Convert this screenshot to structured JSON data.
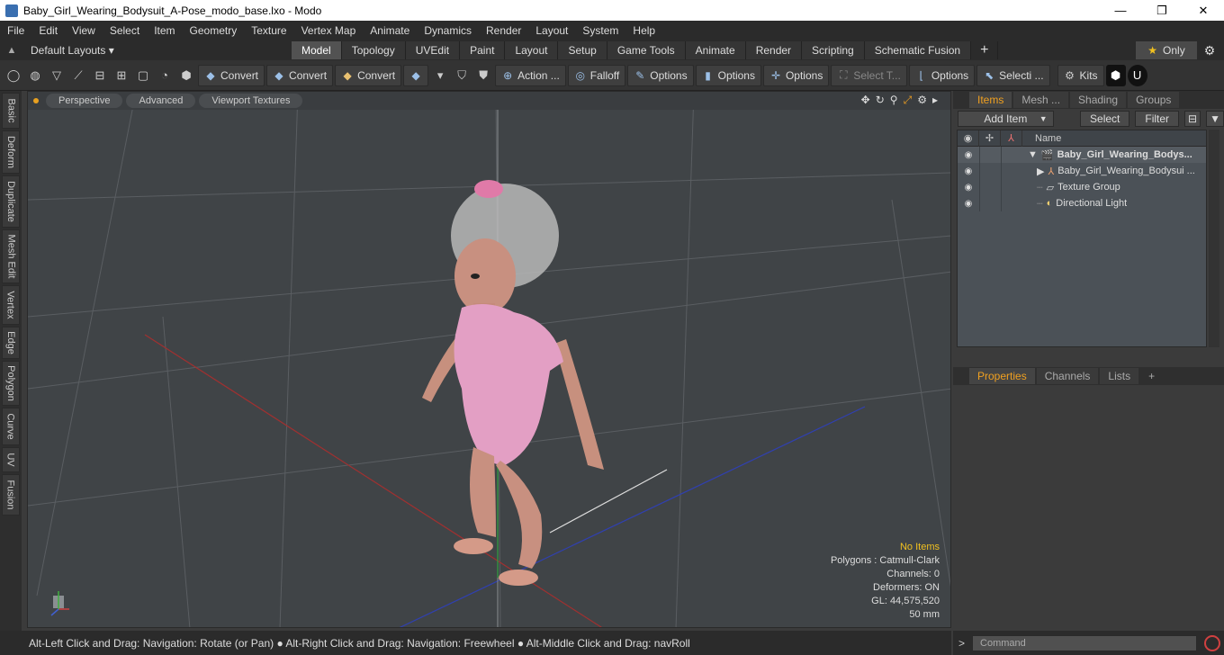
{
  "window": {
    "title": "Baby_Girl_Wearing_Bodysuit_A-Pose_modo_base.lxo - Modo",
    "controls": [
      "—",
      "❐",
      "✕"
    ]
  },
  "menu": [
    "File",
    "Edit",
    "View",
    "Select",
    "Item",
    "Geometry",
    "Texture",
    "Vertex Map",
    "Animate",
    "Dynamics",
    "Render",
    "Layout",
    "System",
    "Help"
  ],
  "layout_bar": {
    "layouts_label": "Default Layouts ▾",
    "tabs": [
      "Model",
      "Topology",
      "UVEdit",
      "Paint",
      "Layout",
      "Setup",
      "Game Tools",
      "Animate",
      "Render",
      "Scripting",
      "Schematic Fusion",
      "+"
    ],
    "active_tab": "Model",
    "only_label": "Only"
  },
  "toolbar": {
    "convert1": "Convert",
    "convert2": "Convert",
    "convert3": "Convert",
    "action": "Action ...",
    "falloff": "Falloff",
    "options1": "Options",
    "options2": "Options",
    "options3": "Options",
    "select_t": "Select T...",
    "options4": "Options",
    "selecti": "Selecti ...",
    "kits": "Kits"
  },
  "left_tabs": [
    "Basic",
    "Deform",
    "Duplicate",
    "Mesh Edit",
    "Vertex",
    "Edge",
    "Polygon",
    "Curve",
    "UV",
    "Fusion"
  ],
  "viewport": {
    "tabs": [
      "Perspective",
      "Advanced",
      "Viewport Textures"
    ],
    "info": {
      "no_items": "No Items",
      "polygons": "Polygons : Catmull-Clark",
      "channels": "Channels: 0",
      "deformers": "Deformers: ON",
      "gl": "GL: 44,575,520",
      "distance": "50 mm"
    }
  },
  "status_bar": "Alt-Left Click and Drag: Navigation: Rotate (or Pan) ● Alt-Right Click and Drag: Navigation: Freewheel ● Alt-Middle Click and Drag: navRoll",
  "items_panel": {
    "tabs": [
      "Items",
      "Mesh ...",
      "Shading",
      "Groups"
    ],
    "add_item": "Add Item",
    "select": "Select",
    "filter": "Filter",
    "name_header": "Name",
    "rows": [
      {
        "name": "Baby_Girl_Wearing_Bodys..."
      },
      {
        "name": "Baby_Girl_Wearing_Bodysui ..."
      },
      {
        "name": "Texture Group"
      },
      {
        "name": "Directional Light"
      }
    ]
  },
  "properties_panel": {
    "tabs": [
      "Properties",
      "Channels",
      "Lists",
      "+"
    ]
  },
  "command": {
    "placeholder": "Command"
  }
}
